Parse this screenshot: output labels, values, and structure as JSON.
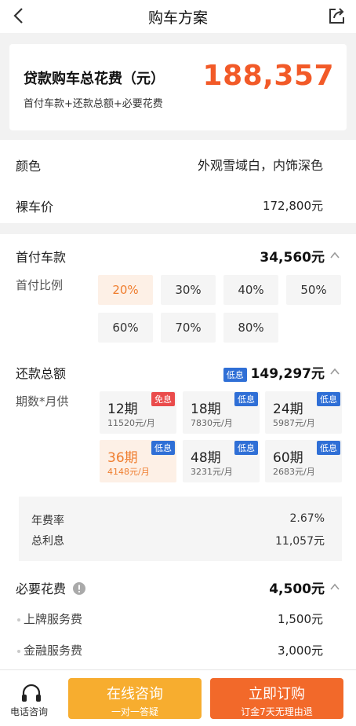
{
  "header": {
    "title": "购车方案"
  },
  "summary": {
    "label": "贷款购车总花费（元）",
    "sub": "首付车款+还款总额+必要花费",
    "total": "188,357"
  },
  "color_row": {
    "label": "颜色",
    "value": "外观雪域白，内饰深色"
  },
  "price_row": {
    "label": "裸车价",
    "value": "172,800元"
  },
  "down_payment": {
    "label": "首付车款",
    "value": "34,560元",
    "ratio_label": "首付比例",
    "options": [
      "20%",
      "30%",
      "40%",
      "50%",
      "60%",
      "70%",
      "80%"
    ],
    "selected": "20%"
  },
  "repayment": {
    "label": "还款总额",
    "badge": "低息",
    "value": "149,297元",
    "term_label": "期数*月供",
    "terms": [
      {
        "name": "12期",
        "monthly": "11520元/月",
        "badge": "免息",
        "badge_color": "#ea4b4b"
      },
      {
        "name": "18期",
        "monthly": "7830元/月",
        "badge": "低息",
        "badge_color": "#2f6fd6"
      },
      {
        "name": "24期",
        "monthly": "5987元/月",
        "badge": "低息",
        "badge_color": "#2f6fd6"
      },
      {
        "name": "36期",
        "monthly": "4148元/月",
        "badge": "低息",
        "badge_color": "#2f6fd6"
      },
      {
        "name": "48期",
        "monthly": "3231元/月",
        "badge": "低息",
        "badge_color": "#2f6fd6"
      },
      {
        "name": "60期",
        "monthly": "2683元/月",
        "badge": "低息",
        "badge_color": "#2f6fd6"
      }
    ],
    "selected_term": "36期",
    "annual_rate_label": "年费率",
    "annual_rate": "2.67%",
    "total_interest_label": "总利息",
    "total_interest": "11,057元"
  },
  "required_fees": {
    "label": "必要花费",
    "value": "4,500元",
    "items": [
      {
        "label": "上牌服务费",
        "value": "1,500元"
      },
      {
        "label": "金融服务费",
        "value": "3,000元"
      }
    ]
  },
  "bottom_bar": {
    "phone_label": "电话咨询",
    "online": {
      "label": "在线咨询",
      "sub": "一对一答疑"
    },
    "order": {
      "label": "立即订购",
      "sub": "订金7天无理由退"
    }
  },
  "colors": {
    "accent": "#f25a28",
    "blue_badge": "#2f6fd6",
    "red_badge": "#ea4b4b",
    "yellow_button": "#f7ad2f",
    "orange_button": "#f2692a"
  }
}
